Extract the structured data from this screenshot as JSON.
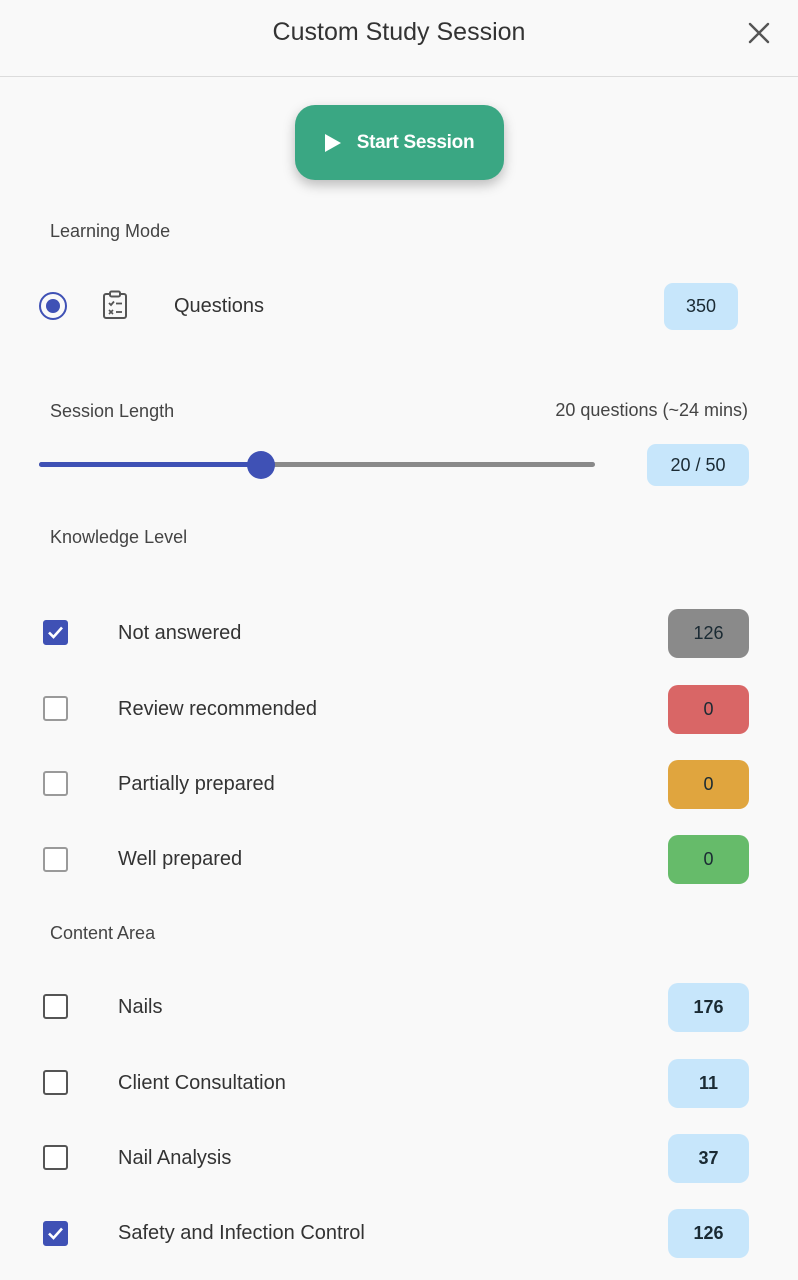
{
  "header": {
    "title": "Custom Study Session",
    "close_icon": "close-icon"
  },
  "start_button": {
    "label": "Start Session",
    "icon": "play-icon"
  },
  "learning_mode": {
    "section_label": "Learning Mode",
    "option": {
      "label": "Questions",
      "icon": "clipboard-list-icon",
      "selected": true,
      "count": "350"
    }
  },
  "session_length": {
    "section_label": "Session Length",
    "summary": "20 questions (~24 mins)",
    "badge": "20 / 50",
    "value": 20,
    "max": 50
  },
  "knowledge_level": {
    "section_label": "Knowledge Level",
    "items": [
      {
        "label": "Not answered",
        "count": "126",
        "checked": true,
        "color": "#8a8a8a"
      },
      {
        "label": "Review recommended",
        "count": "0",
        "checked": false,
        "color": "#d96666"
      },
      {
        "label": "Partially prepared",
        "count": "0",
        "checked": false,
        "color": "#e0a53e"
      },
      {
        "label": "Well prepared",
        "count": "0",
        "checked": false,
        "color": "#66bb6a"
      }
    ]
  },
  "content_area": {
    "section_label": "Content Area",
    "items": [
      {
        "label": "Nails",
        "count": "176",
        "checked": false
      },
      {
        "label": "Client Consultation",
        "count": "11",
        "checked": false
      },
      {
        "label": "Nail Analysis",
        "count": "37",
        "checked": false
      },
      {
        "label": "Safety and Infection Control",
        "count": "126",
        "checked": true
      }
    ]
  },
  "colors": {
    "accent": "#3f51b5",
    "start_button": "#3aa783",
    "count_badge": "#c7e6fb"
  }
}
